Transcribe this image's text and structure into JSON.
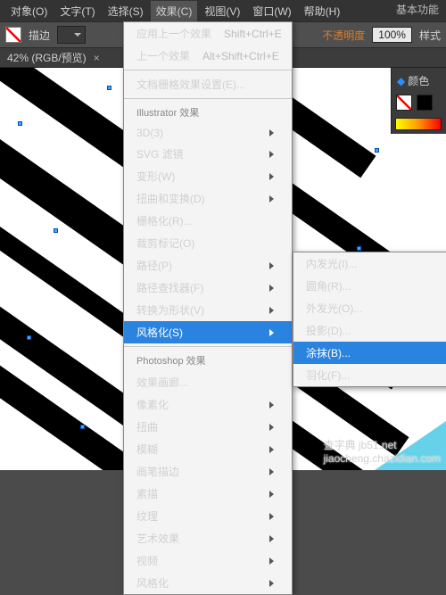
{
  "topRight": "基本功能",
  "menubar": {
    "items": [
      "对象(O)",
      "文字(T)",
      "选择(S)",
      "效果(C)",
      "视图(V)",
      "窗口(W)",
      "帮助(H)"
    ]
  },
  "toolbar": {
    "strokeLabel": "描边",
    "opacityLabel": "不透明度",
    "opacityValue": "100%",
    "styleLabel": "样式"
  },
  "tab": {
    "label": "42% (RGB/预览)",
    "close": "×"
  },
  "panel": {
    "title": "颜色"
  },
  "effectsMenu": {
    "top": [
      {
        "label": "应用上一个效果",
        "accel": "Shift+Ctrl+E",
        "disabled": true
      },
      {
        "label": "上一个效果",
        "accel": "Alt+Shift+Ctrl+E",
        "disabled": true
      }
    ],
    "docRaster": "文档栅格效果设置(E)...",
    "aiHeading": "Illustrator 效果",
    "ai": [
      {
        "label": "3D(3)",
        "sub": true
      },
      {
        "label": "SVG 滤镜",
        "sub": true
      },
      {
        "label": "变形(W)",
        "sub": true
      },
      {
        "label": "扭曲和变换(D)",
        "sub": true
      },
      {
        "label": "栅格化(R)..."
      },
      {
        "label": "裁剪标记(O)"
      },
      {
        "label": "路径(P)",
        "sub": true
      },
      {
        "label": "路径查找器(F)",
        "sub": true
      },
      {
        "label": "转换为形状(V)",
        "sub": true
      },
      {
        "label": "风格化(S)",
        "sub": true,
        "hi": true
      }
    ],
    "psHeading": "Photoshop 效果",
    "ps": [
      {
        "label": "效果画廊..."
      },
      {
        "label": "像素化",
        "sub": true
      },
      {
        "label": "扭曲",
        "sub": true
      },
      {
        "label": "模糊",
        "sub": true
      },
      {
        "label": "画笔描边",
        "sub": true
      },
      {
        "label": "素描",
        "sub": true
      },
      {
        "label": "纹理",
        "sub": true
      },
      {
        "label": "艺术效果",
        "sub": true
      },
      {
        "label": "视频",
        "sub": true
      },
      {
        "label": "风格化",
        "sub": true
      }
    ]
  },
  "stylizeSub": [
    {
      "label": "内发光(I)..."
    },
    {
      "label": "圆角(R)..."
    },
    {
      "label": "外发光(O)..."
    },
    {
      "label": "投影(D)..."
    },
    {
      "label": "涂抹(B)...",
      "hi": true
    },
    {
      "label": "羽化(F)..."
    }
  ],
  "watermark": {
    "l1": "查字典 jb51.net",
    "l2": "jiaocheng.chazidian.com"
  }
}
